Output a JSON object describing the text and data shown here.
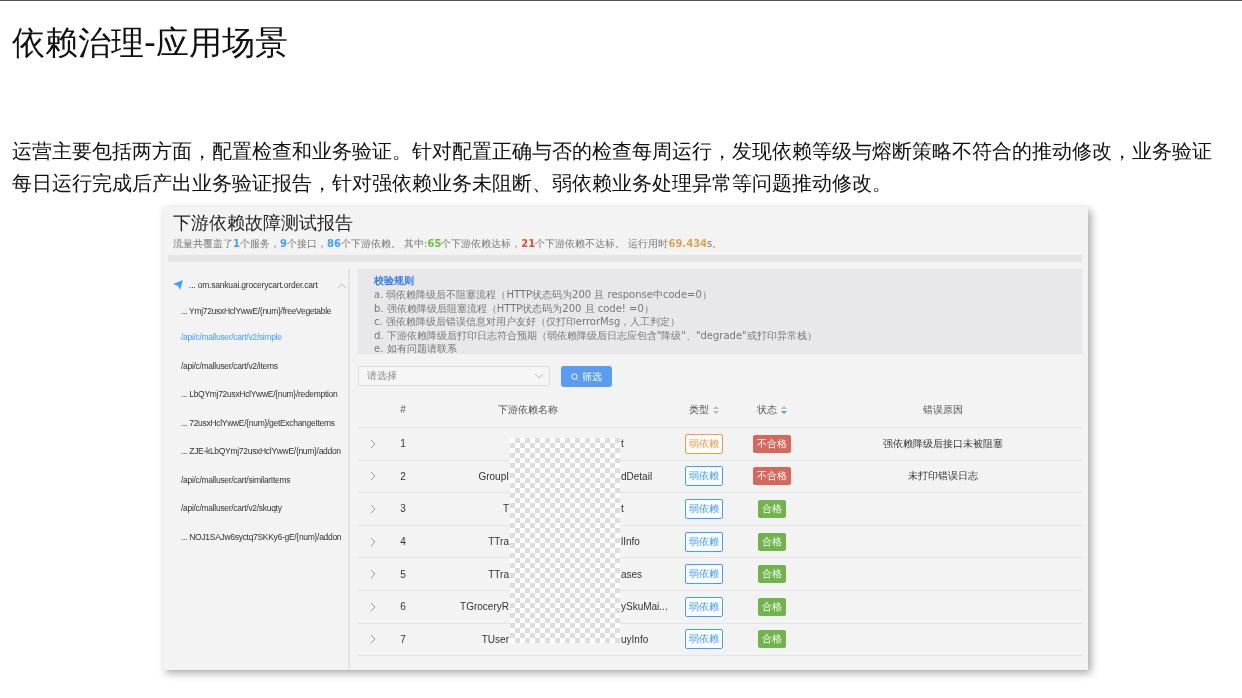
{
  "slide": {
    "title": "依赖治理-应用场景",
    "paragraph": "运营主要包括两方面，配置检查和业务验证。针对配置正确与否的检查每周运行，发现依赖等级与熔断策略不符合的推动修改，业务验证每日运行完成后产出业务验证报告，针对强依赖业务未阻断、弱依赖业务处理异常等问题推动修改。"
  },
  "report": {
    "title": "下游依赖故障测试报告",
    "summary": [
      {
        "text": "流量共覆盖了"
      },
      {
        "text": "1",
        "color": "#409eff"
      },
      {
        "text": "个服务，"
      },
      {
        "text": "9",
        "color": "#409eff"
      },
      {
        "text": "个接口，"
      },
      {
        "text": "86",
        "color": "#409eff"
      },
      {
        "text": "个下游依赖。 其中:"
      },
      {
        "text": "65",
        "color": "#67c23a"
      },
      {
        "text": "个下游依赖达标，"
      },
      {
        "text": "21",
        "color": "#e64b2e"
      },
      {
        "text": "个下游依赖不达标。 运行用时"
      },
      {
        "text": "69.434",
        "color": "#d9a54a"
      },
      {
        "text": "s。"
      }
    ],
    "sidebar": {
      "service": "... om.sankuai.grocerycart.order.cart",
      "expanded": true,
      "items": [
        {
          "label": "... Ymj72usxHclYwwE/{num}/freeVegetable",
          "selected": false
        },
        {
          "label": "/api/c/malluser/cart/v2/simple",
          "selected": true
        },
        {
          "label": "/api/c/malluser/cart/v2/items",
          "selected": false
        },
        {
          "label": "... LbQYmj72usxHclYwwE/{num}/redemption",
          "selected": false
        },
        {
          "label": "... 72usxHclYwwE/{num}/getExchangeItems",
          "selected": false
        },
        {
          "label": "... ZJE-kLbQYmj72usxHclYwwE/{num}/addon",
          "selected": false
        },
        {
          "label": "/api/c/malluser/cart/similarItems",
          "selected": false
        },
        {
          "label": "/api/c/malluser/cart/v2/skuqty",
          "selected": false
        },
        {
          "label": "... NOJ1SAJw6syctq7SKKy6-gE/{num}/addon",
          "selected": false
        }
      ]
    },
    "rules": {
      "title": "校验规则",
      "lines": [
        "a. 弱依赖降级后不阻塞流程（HTTP状态码为200 且 response中code=0）",
        "b. 强依赖降级后阻塞流程（HTTP状态码为200 且 code! =0）",
        "c. 强依赖降级后错误信息对用户友好（仅打印errorMsg，人工判定）",
        "d. 下游依赖降级后打印日志符合预期（弱依赖降级后日志应包含\"降级\"、\"degrade\"或打印异常栈）",
        "e. 如有问题请联系"
      ]
    },
    "filter": {
      "placeholder": "请选择",
      "button": "筛选"
    },
    "columns": [
      "#",
      "下游依赖名称",
      "类型",
      "状态",
      "错误原因"
    ],
    "rows": [
      {
        "index": "1",
        "name_right": "t",
        "type": "弱依赖",
        "color": "#e6a23c",
        "status": "不合格",
        "passed": false,
        "reason": "强依赖降级后接口未被阻塞"
      },
      {
        "index": "2",
        "name_left": "GroupI",
        "name_right": "dDetail",
        "type": "弱依赖",
        "color": "#409eff",
        "status": "不合格",
        "passed": false,
        "reason": "未打印错误日志"
      },
      {
        "index": "3",
        "name_left": "T",
        "name_right": "t",
        "type": "弱依赖",
        "color": "#409eff",
        "status": "合格",
        "passed": true
      },
      {
        "index": "4",
        "name_left": "TTra",
        "name_right": "lInfo",
        "type": "弱依赖",
        "color": "#409eff",
        "status": "合格",
        "passed": true
      },
      {
        "index": "5",
        "name_left": "TTra",
        "name_right": "ases",
        "type": "弱依赖",
        "color": "#409eff",
        "status": "合格",
        "passed": true
      },
      {
        "index": "6",
        "name_left": "TGroceryR",
        "name_right": "ySkuMai...",
        "type": "弱依赖",
        "color": "#409eff",
        "status": "合格",
        "passed": true
      },
      {
        "index": "7",
        "name_left": "TUser",
        "name_right": "uyInfo",
        "type": "弱依赖",
        "color": "#409eff",
        "status": "合格",
        "passed": true
      }
    ]
  }
}
